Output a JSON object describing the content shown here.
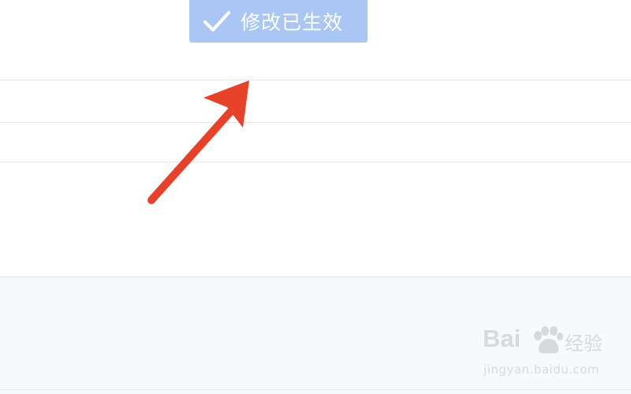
{
  "toast": {
    "icon": "checkmark-icon",
    "message": "修改已生效"
  },
  "annotation": {
    "icon": "red-arrow-icon",
    "color": "#e8412a"
  },
  "watermark": {
    "brand_left": "Bai",
    "paw_icon": "baidu-paw-icon",
    "brand_right": "经验",
    "url": "jingyan.baidu.com"
  },
  "colors": {
    "toast_background": "#a9c6f5",
    "footer_background": "#f8f9fd",
    "divider": "#e6e6ea",
    "arrow": "#e8412a"
  }
}
